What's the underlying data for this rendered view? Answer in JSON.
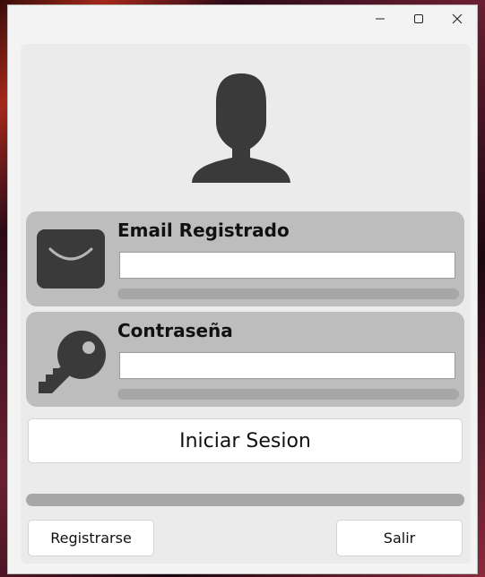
{
  "window": {
    "controls": {
      "minimize": "minimize-icon",
      "maximize": "maximize-icon",
      "close": "close-icon"
    }
  },
  "login": {
    "avatar_icon": "user-silhouette-icon",
    "email": {
      "icon": "envelope-icon",
      "label": "Email Registrado",
      "value": "",
      "placeholder": ""
    },
    "password": {
      "icon": "key-icon",
      "label": "Contraseña",
      "value": "",
      "placeholder": ""
    },
    "submit_label": "Iniciar Sesion",
    "register_label": "Registrarse",
    "exit_label": "Salir"
  },
  "colors": {
    "panel": "#ebebeb",
    "group": "#bdbdbd",
    "bar": "#a7a7a7",
    "icon": "#3a3a3a"
  }
}
